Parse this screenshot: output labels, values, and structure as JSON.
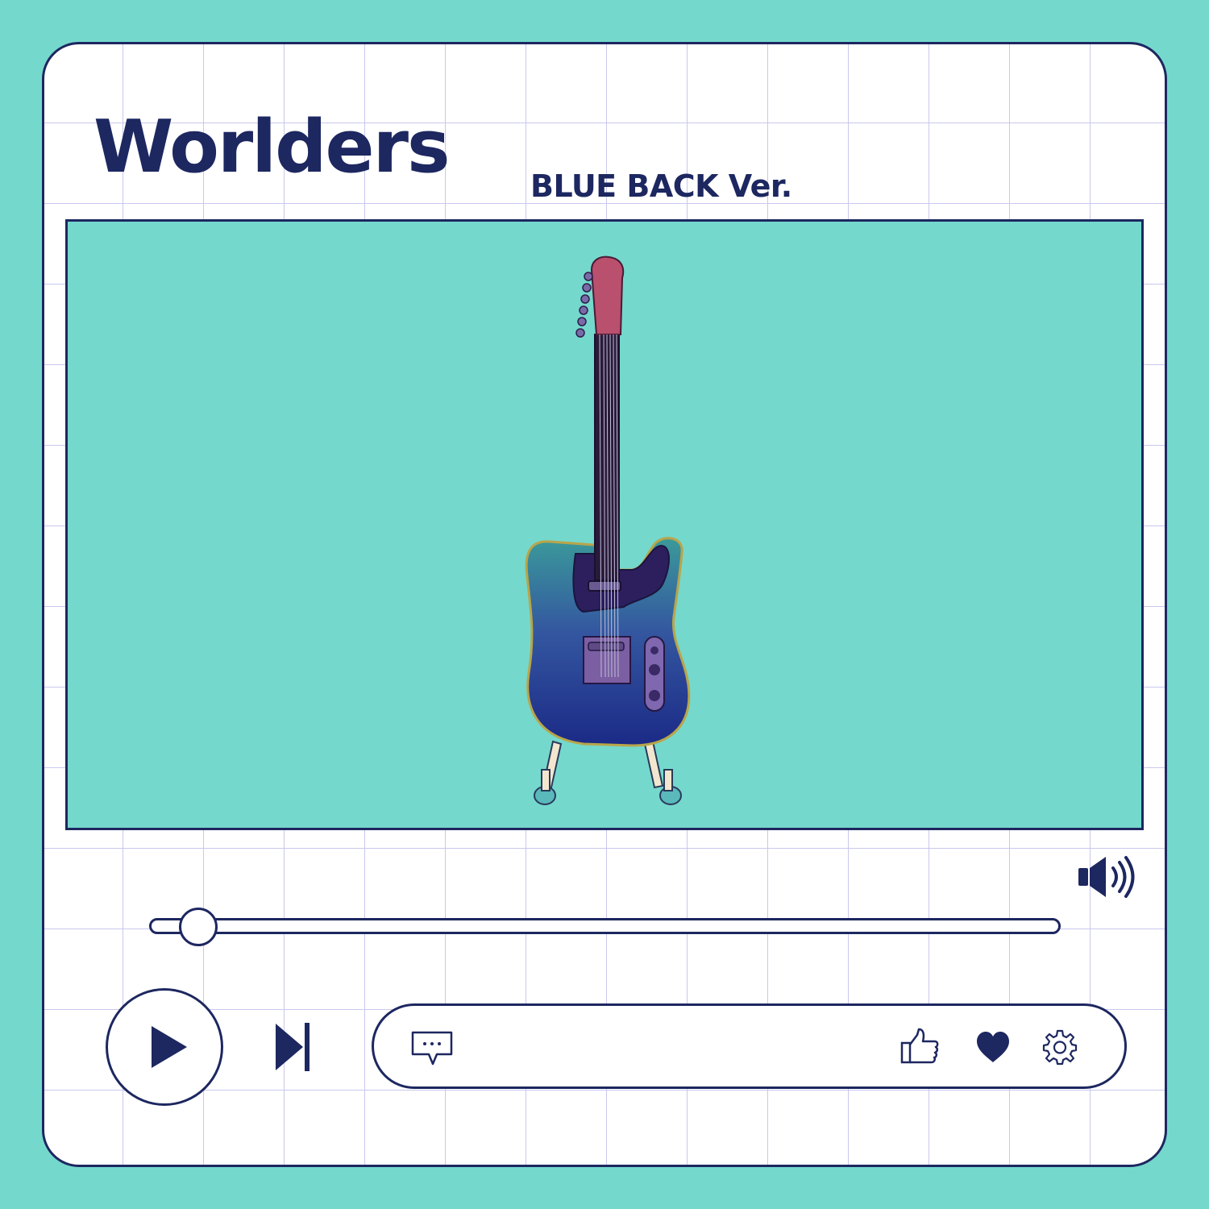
{
  "header": {
    "title": "Worlders",
    "subtitle": "BLUE BACK Ver."
  },
  "colors": {
    "background": "#75d8cc",
    "accent": "#1d2760",
    "grid": "#c9c8ee",
    "card": "#ffffff"
  },
  "player": {
    "progress_fraction": 0.04,
    "volume_icon": "speaker-volume-icon",
    "play_icon": "play-icon",
    "next_icon": "skip-next-icon",
    "comment_icon": "comment-bubble-icon",
    "like_icon": "thumbs-up-icon",
    "favorite_icon": "heart-icon",
    "settings_icon": "gear-icon"
  },
  "video": {
    "content": "guitar-illustration"
  }
}
